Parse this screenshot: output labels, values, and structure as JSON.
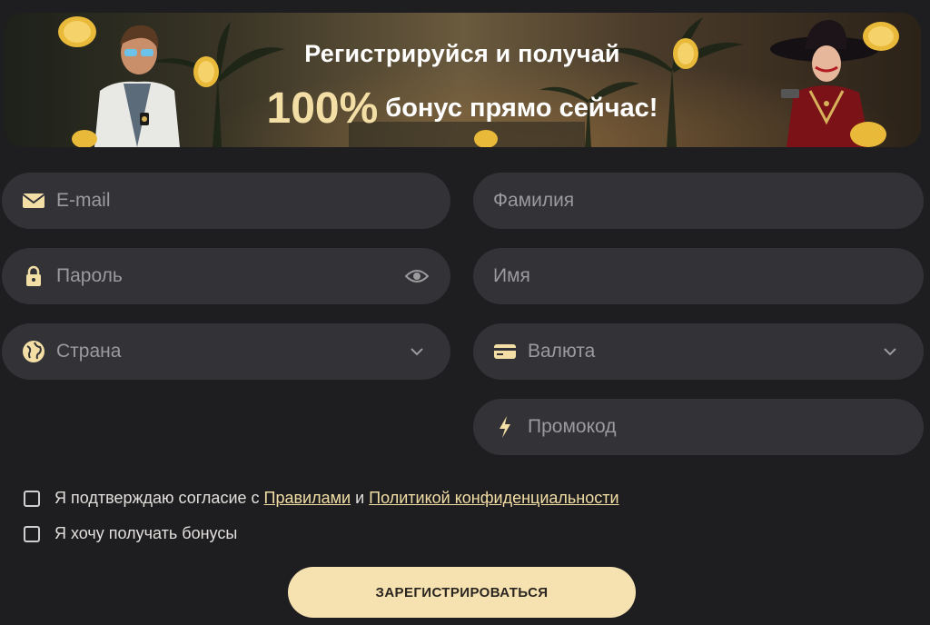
{
  "banner": {
    "title_line1": "Регистрируйся и получай",
    "title_percent": "100%",
    "title_line2_rest": "бонус прямо сейчас!"
  },
  "form": {
    "email": {
      "placeholder": "E-mail",
      "icon": "envelope-icon"
    },
    "surname": {
      "placeholder": "Фамилия"
    },
    "password": {
      "placeholder": "Пароль",
      "icon": "lock-icon",
      "trail_icon": "eye-icon"
    },
    "first_name": {
      "placeholder": "Имя"
    },
    "country": {
      "placeholder": "Страна",
      "icon": "globe-icon",
      "trail_icon": "chevron-down-icon"
    },
    "currency": {
      "placeholder": "Валюта",
      "icon": "credit-card-icon",
      "trail_icon": "chevron-down-icon"
    },
    "promo": {
      "placeholder": "Промокод",
      "icon": "lightning-icon"
    }
  },
  "consent": {
    "prefix": "Я подтверждаю согласие с",
    "rules_link": "Правилами",
    "conjunction": "и",
    "privacy_link": "Политикой конфиденциальности",
    "checked": false
  },
  "bonus_opt_in": {
    "label": "Я хочу получать бонусы",
    "checked": false
  },
  "submit_label": "ЗАРЕГИСТРИРОВАТЬСЯ",
  "colors": {
    "background": "#1e1d1f",
    "field": "#333236",
    "accent": "#f6e2b0",
    "gold_text": "#f3dfa6"
  }
}
